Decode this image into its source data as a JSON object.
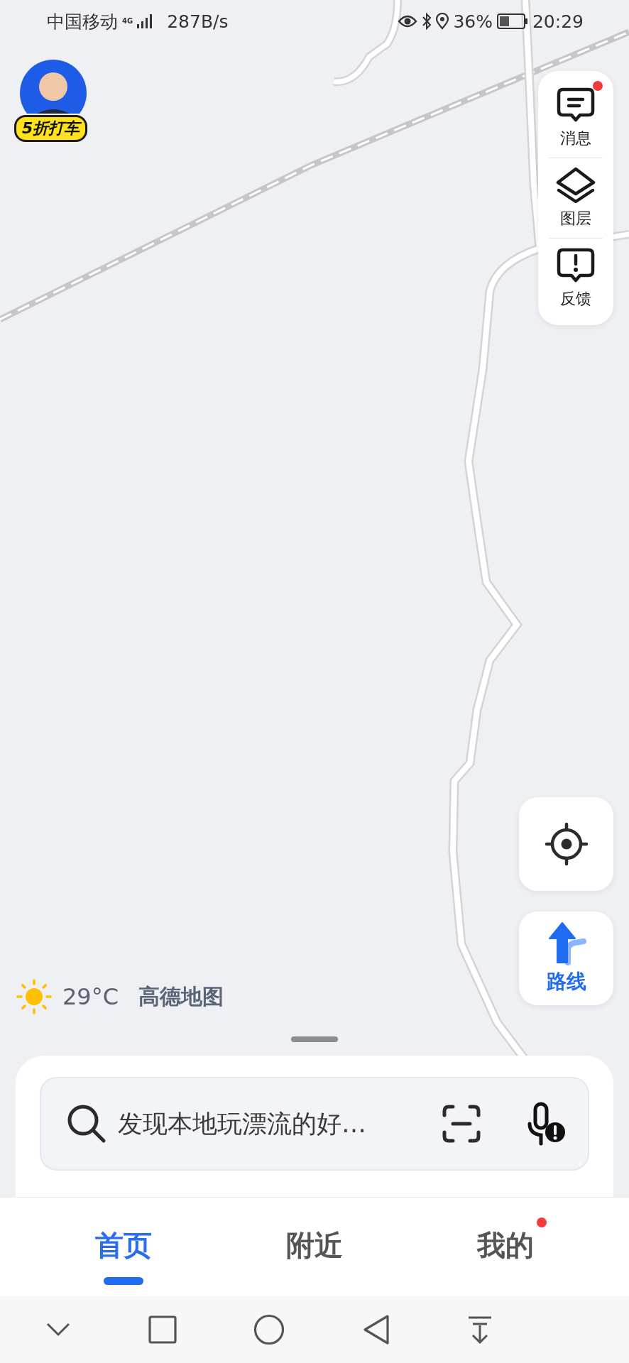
{
  "status_bar": {
    "carrier": "中国移动",
    "network": "4G",
    "speed": "287B/s",
    "battery": "36%",
    "time": "20:29"
  },
  "promo": {
    "badge": "5折打车"
  },
  "side_panel": [
    {
      "label": "消息",
      "kind": "message",
      "badge": true
    },
    {
      "label": "图层",
      "kind": "layers",
      "badge": false
    },
    {
      "label": "反馈",
      "kind": "feedback",
      "badge": false
    }
  ],
  "route_button": {
    "label": "路线"
  },
  "weather": {
    "temperature": "29°C",
    "brand": "高德地图"
  },
  "search": {
    "placeholder": "发现本地玩漂流的好…"
  },
  "tabs": [
    {
      "label": "首页",
      "selected": true,
      "badge": false
    },
    {
      "label": "附近",
      "selected": false,
      "badge": false
    },
    {
      "label": "我的",
      "selected": false,
      "badge": true
    }
  ]
}
